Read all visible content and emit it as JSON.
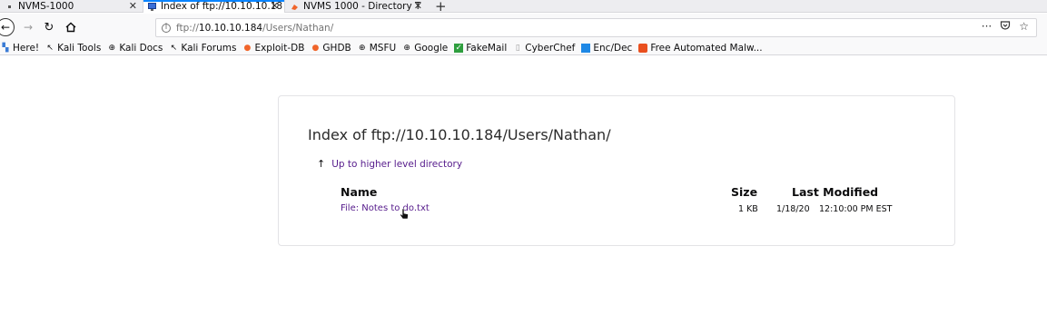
{
  "tabs": [
    {
      "title": "NVMS-1000",
      "icon": "nvms-favicon",
      "close": "✕"
    },
    {
      "title": "Index of ftp://10.10.10.18",
      "icon": "ftp-favicon",
      "close": "✕"
    },
    {
      "title": "NVMS 1000 - Directory T",
      "icon": "exploit-favicon",
      "close": "✕"
    }
  ],
  "new_tab": "+",
  "nav": {
    "back_icon": "back-arrow-icon",
    "forward_icon": "forward-arrow-icon",
    "reload_icon": "reload-icon",
    "home_icon": "home-icon"
  },
  "url": {
    "scheme": "ftp://",
    "host": "10.10.10.184",
    "path": "/Users/Nathan/",
    "info_icon": "info-icon",
    "more_icon": "···",
    "pocket_icon": "pocket-icon",
    "star_icon": "star-icon"
  },
  "bookmarks": [
    {
      "label": "Here!",
      "icon": "bookmark-icon"
    },
    {
      "label": "Kali Tools",
      "icon": "kali-icon"
    },
    {
      "label": "Kali Docs",
      "icon": "globe-icon"
    },
    {
      "label": "Kali Forums",
      "icon": "kali-icon"
    },
    {
      "label": "Exploit-DB",
      "icon": "exploit-icon"
    },
    {
      "label": "GHDB",
      "icon": "exploit-icon"
    },
    {
      "label": "MSFU",
      "icon": "globe-icon"
    },
    {
      "label": "Google",
      "icon": "globe-icon"
    },
    {
      "label": "FakeMail",
      "icon": "fakemail-icon"
    },
    {
      "label": "CyberChef",
      "icon": "cyberchef-icon"
    },
    {
      "label": "Enc/Dec",
      "icon": "encdec-icon"
    },
    {
      "label": "Free Automated Malw...",
      "icon": "malware-icon"
    }
  ],
  "page": {
    "heading": "Index of ftp://10.10.10.184/Users/Nathan/",
    "up_link": "Up to higher level directory",
    "columns": {
      "name": "Name",
      "size": "Size",
      "modified": "Last Modified"
    },
    "files": [
      {
        "name": "File: Notes to do.txt",
        "size": "1 KB",
        "date": "1/18/20",
        "time": "12:10:00 PM EST"
      }
    ]
  },
  "colors": {
    "visited_link": "#551a8b",
    "tab_accent": "#0a84ff"
  }
}
